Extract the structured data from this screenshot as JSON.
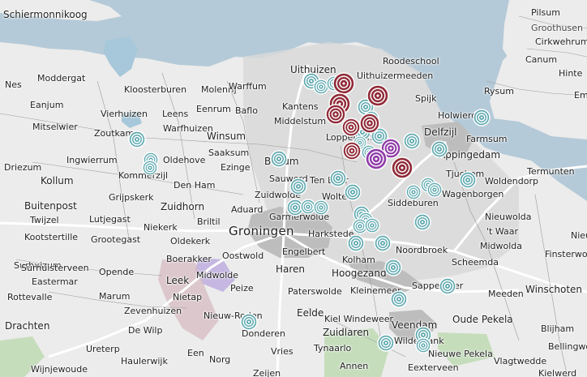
{
  "map": {
    "colors": {
      "sea": "#b5cad8",
      "land": "#ececec",
      "darker_land": "#d9d9d9",
      "urban": "#bdbdbd",
      "water": "#a6c8da",
      "road_major": "#ffffff",
      "road_minor": "#9a9a9a",
      "forest": "#b7d7a8",
      "purple_zone": "#b8a6de",
      "pink_zone": "#d5b8bf"
    },
    "labels": [
      "Schiermonnikoog",
      "Pilsum",
      "Groothusen",
      "Cirkwehrum",
      "Canum",
      "Hinte",
      "Moddergat",
      "Nes",
      "Kloosterburen",
      "Molenrij",
      "Warffum",
      "Uithuizen",
      "Roodeschool",
      "Uithuizermeeden",
      "Rysum",
      "Emd",
      "Eanjum",
      "Vierhuizen",
      "Leens",
      "Eenrum",
      "Baflo",
      "Spijk",
      "Holwierde",
      "Mitselwier",
      "Warfhuizen",
      "Kantens",
      "Middelstum",
      "Zoutkamp",
      "Winsum",
      "Loppersum",
      "Delfzijl",
      "Farmsum",
      "Appingedam",
      "Driezum",
      "Ingwierrum",
      "Saaksum",
      "Oldehove",
      "Bedum",
      "Ezinge",
      "Termunten",
      "Kollum",
      "Kommerzijl",
      "Sauwerd",
      "Ten Boer",
      "Tjuchem",
      "Woldendorp",
      "Grijpskerk",
      "Den Ham",
      "Zuidwolde",
      "Wolters",
      "Wagenborgen",
      "Buitenpost",
      "Zuidhorn",
      "Siddeburen",
      "Twijzel",
      "Lutjegast",
      "Niekerk",
      "Briltil",
      "Aduard",
      "Garmerwolde",
      "Nieuwolda",
      "Kootstertille",
      "Grootegast",
      "Oldekerk",
      "Harkstede",
      "'t Waar",
      "Nieuw",
      "Groningen",
      "Surhuizum",
      "Boerakker",
      "Engelbert",
      "Noordbroek",
      "Midwolda",
      "Finsterwolde",
      "Surhuisterveen",
      "Opende",
      "Oostwold",
      "Haren",
      "Kolham",
      "Scheemda",
      "Eastermar",
      "Leek",
      "Midwolde",
      "Hoogezand",
      "Rottevalle",
      "Marum",
      "Peize",
      "Paterswolde",
      "Kleinemeer",
      "Sappemeer",
      "Meeden",
      "Winschoten",
      "Nietap",
      "Zevenhuizen",
      "Eelde",
      "Drachten",
      "De Wilp",
      "Nieuw-Roden",
      "Kiel Windeweer",
      "Veendam",
      "Oude Pekela",
      "Blijham",
      "Ureterp",
      "Donderen",
      "Zuidlaren",
      "Wildervank",
      "Een",
      "Vries",
      "Tynaarlo",
      "Bellingwolde",
      "Nieuwe Pekela",
      "Haulerwijk",
      "Norg",
      "Annen",
      "Eexterveen",
      "Vlagtwedde",
      "Wijnjewoude",
      "Zeijen",
      "Zuidwolde",
      "Kielwerd"
    ],
    "marker_colors": {
      "teal": "#5aa8ae",
      "dark_red": "#8e2331",
      "purple": "#8c34a6"
    }
  }
}
